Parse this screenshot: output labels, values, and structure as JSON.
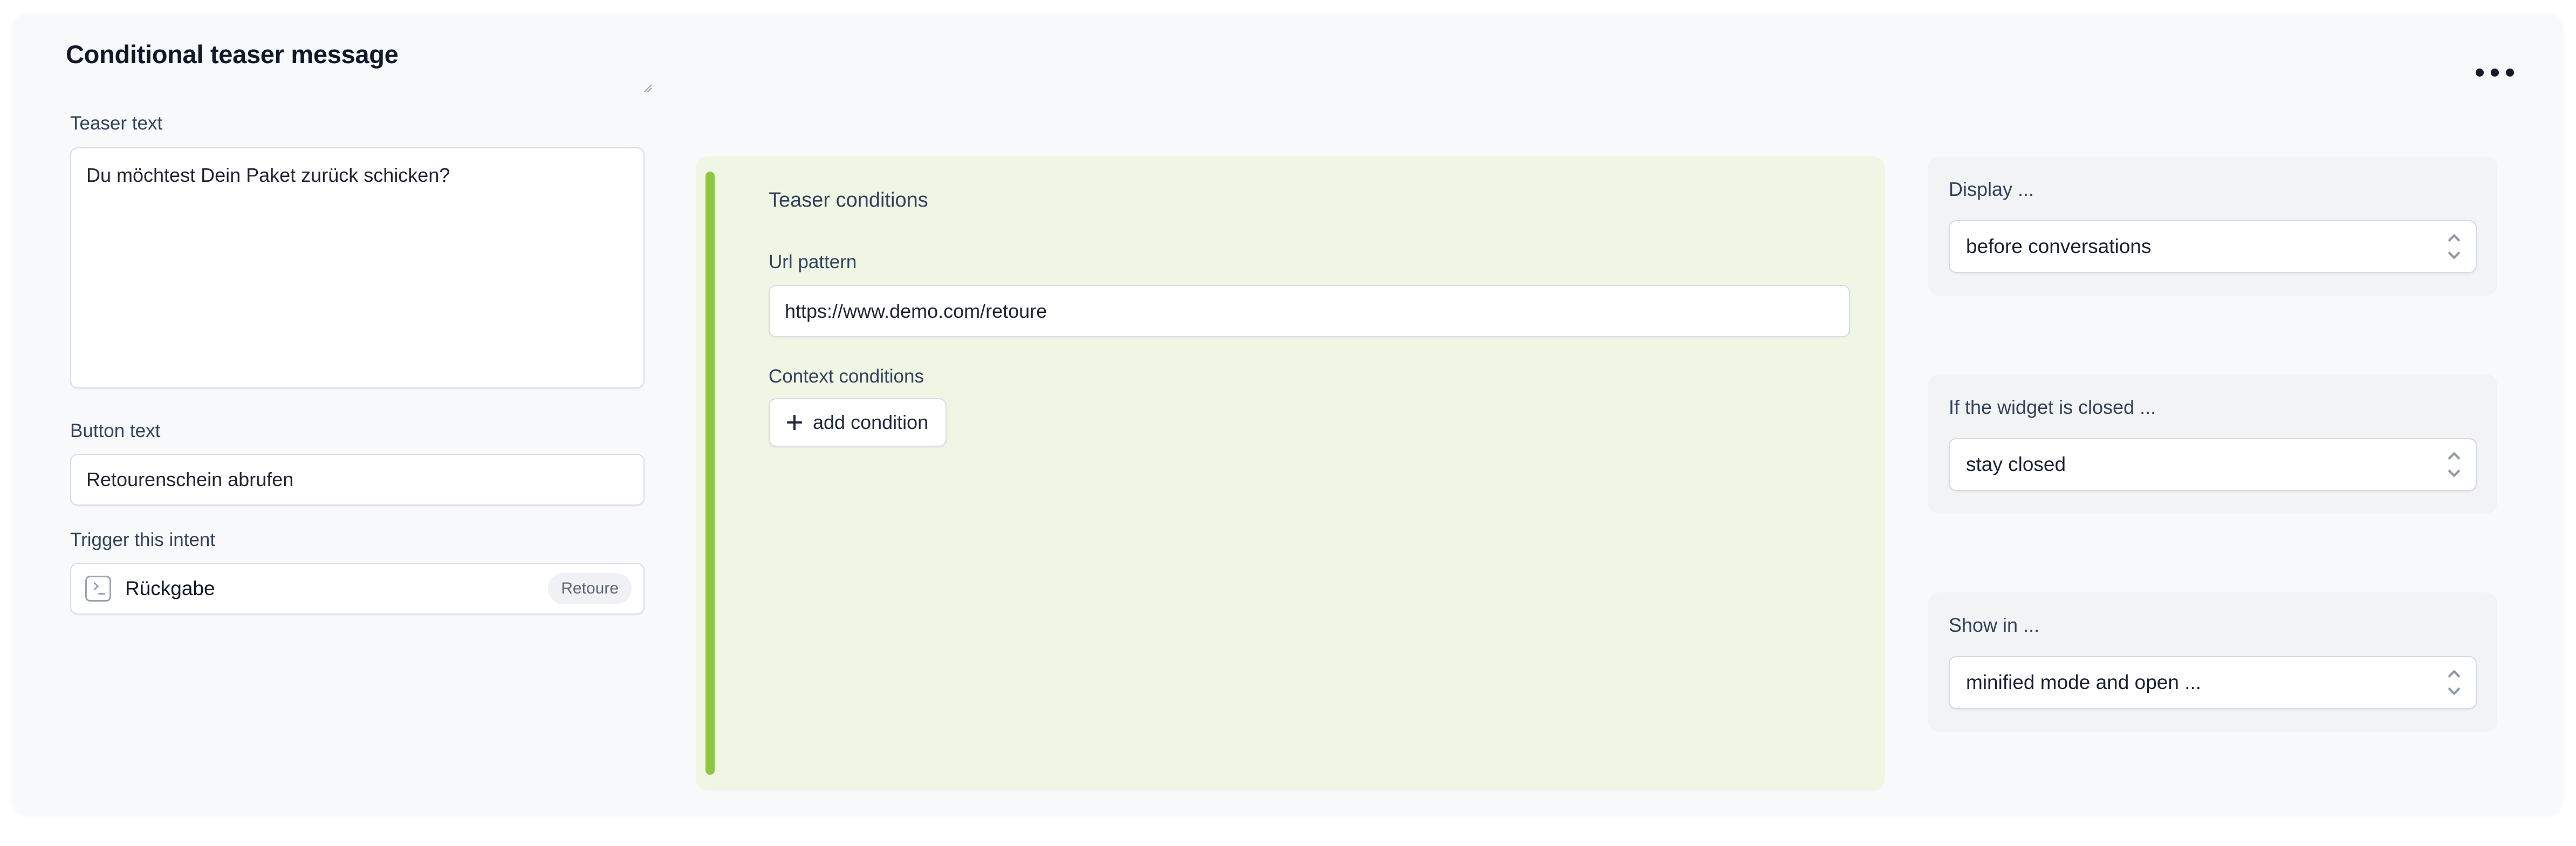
{
  "card": {
    "title": "Conditional teaser message",
    "menu_icon": "kebab-horizontal-icon"
  },
  "left_column": {
    "teaser_text_label": "Teaser text",
    "teaser_text_value": "Du möchtest Dein Paket zurück schicken?",
    "button_text_label": "Button text",
    "button_text_value": "Retourenschein abrufen",
    "trigger_intent_label": "Trigger this intent",
    "intent": {
      "icon": "terminal-icon",
      "name": "Rückgabe",
      "badge": "Retoure"
    }
  },
  "conditions_panel": {
    "heading": "Teaser conditions",
    "url_pattern_label": "Url pattern",
    "url_pattern_value": "https://www.demo.com/retoure",
    "context_conditions_label": "Context conditions",
    "add_condition_label": "add condition",
    "add_condition_icon": "plus-icon",
    "accent_color": "#8ec63f",
    "background_color": "#eff6e4"
  },
  "options": [
    {
      "label": "Display ...",
      "value": "before conversations",
      "icon": "chevron-up-down-icon"
    },
    {
      "label": "If the widget is closed ...",
      "value": "stay closed",
      "icon": "chevron-up-down-icon"
    },
    {
      "label": "Show in ...",
      "value": "minified mode and open ...",
      "icon": "chevron-up-down-icon"
    }
  ]
}
